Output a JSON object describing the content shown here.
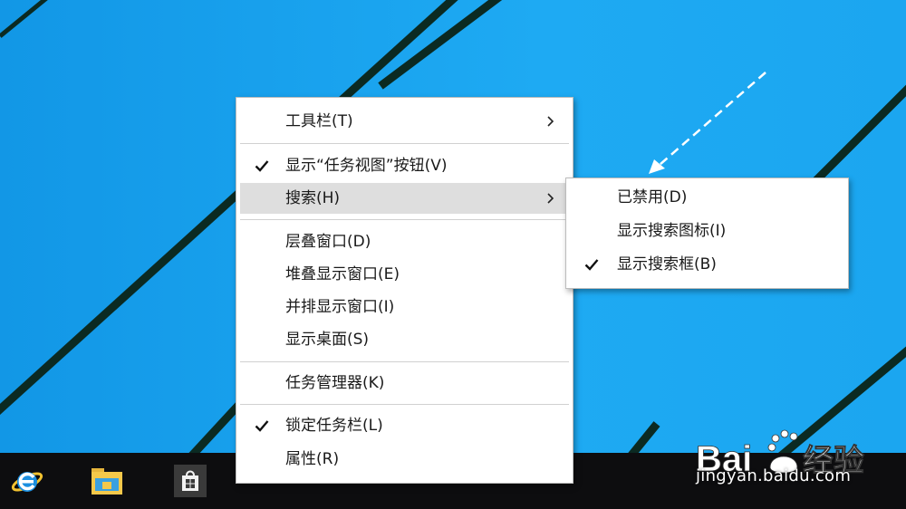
{
  "context_menu": {
    "items": [
      {
        "label": "工具栏(T)",
        "checked": false,
        "submenu": true
      },
      {
        "label": "显示“任务视图”按钮(V)",
        "checked": true,
        "submenu": false
      },
      {
        "label": "搜索(H)",
        "checked": false,
        "submenu": true,
        "highlighted": true
      },
      {
        "label": "层叠窗口(D)",
        "checked": false,
        "submenu": false
      },
      {
        "label": "堆叠显示窗口(E)",
        "checked": false,
        "submenu": false
      },
      {
        "label": "并排显示窗口(I)",
        "checked": false,
        "submenu": false
      },
      {
        "label": "显示桌面(S)",
        "checked": false,
        "submenu": false
      },
      {
        "label": "任务管理器(K)",
        "checked": false,
        "submenu": false
      },
      {
        "label": "锁定任务栏(L)",
        "checked": true,
        "submenu": false
      },
      {
        "label": "属性(R)",
        "checked": false,
        "submenu": false
      }
    ]
  },
  "search_submenu": {
    "items": [
      {
        "label": "已禁用(D)",
        "checked": false
      },
      {
        "label": "显示搜索图标(I)",
        "checked": false
      },
      {
        "label": "显示搜索框(B)",
        "checked": true
      }
    ]
  },
  "taskbar": {
    "apps": [
      {
        "icon": "internet-explorer-icon"
      },
      {
        "icon": "file-explorer-icon"
      },
      {
        "icon": "store-icon"
      }
    ]
  },
  "watermark": {
    "logo_text": "Bai经验",
    "url": "jingyan.baidu.com"
  },
  "colors": {
    "desktop": "#1aa3ee",
    "taskbar": "#0d0d0f",
    "menu_bg": "#ffffff",
    "menu_highlight": "#dedede"
  }
}
